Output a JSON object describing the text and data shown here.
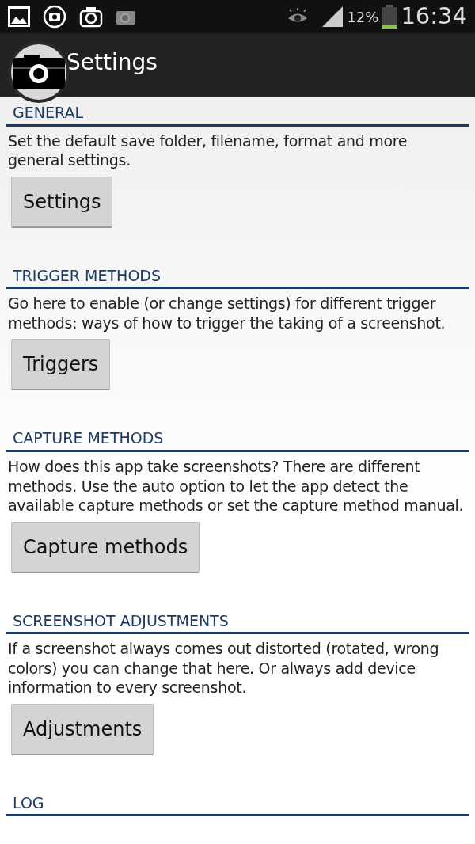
{
  "status_bar": {
    "battery_percent": "12%",
    "time": "16:34"
  },
  "action_bar": {
    "title": "Settings"
  },
  "sections": [
    {
      "heading": "GENERAL",
      "description": "Set the default save folder, filename, format and more general settings.",
      "button": "Settings"
    },
    {
      "heading": "TRIGGER METHODS",
      "description": "Go here to enable (or change settings) for different trigger methods: ways of how to trigger the taking of a screenshot.",
      "button": "Triggers"
    },
    {
      "heading": "CAPTURE METHODS",
      "description": "How does this app take screenshots? There are different methods. Use the auto option to let the app detect the available capture methods or set the capture method manual.",
      "button": "Capture methods"
    },
    {
      "heading": "SCREENSHOT ADJUSTMENTS",
      "description": "If a screenshot always comes out distorted (rotated, wrong colors) you can change that here. Or always add device information to every screenshot.",
      "button": "Adjustments"
    },
    {
      "heading": "LOG"
    }
  ]
}
